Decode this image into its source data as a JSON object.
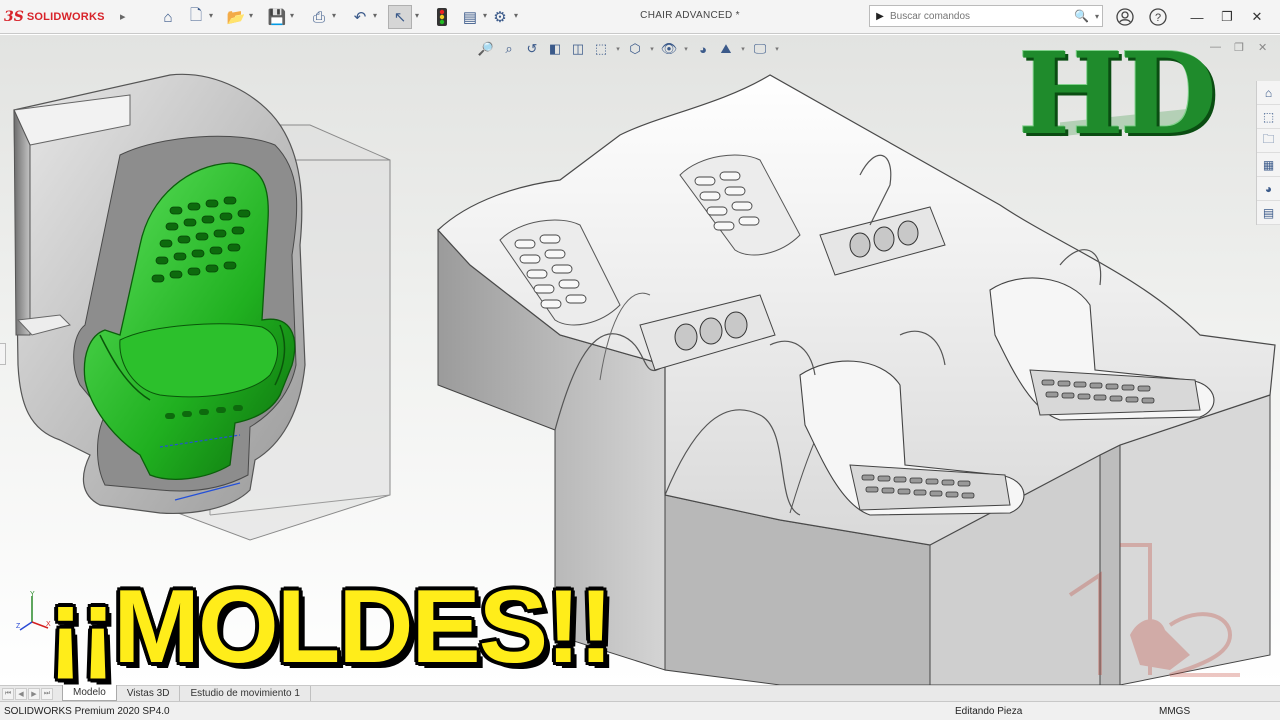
{
  "app": {
    "logo_prefix": "3S",
    "logo_name": "SOLIDWORKS"
  },
  "titlebar": {
    "document_title": "CHAIR ADVANCED *",
    "search_placeholder": "Buscar comandos"
  },
  "overlay": {
    "hd_label": "HD",
    "headline": "¡¡MOLDES!!"
  },
  "triad": {
    "x": "X",
    "y": "Y",
    "z": "Z"
  },
  "tabs": [
    {
      "label": "Modelo",
      "active": true
    },
    {
      "label": "Vistas 3D",
      "active": false
    },
    {
      "label": "Estudio de movimiento 1",
      "active": false
    }
  ],
  "status": {
    "product": "SOLIDWORKS Premium 2020 SP4.0",
    "mode": "Editando Pieza",
    "units": "MMGS"
  },
  "colors": {
    "accent": "#d8232a",
    "part_green": "#2fbf2f",
    "hd_green": "#1f8b2c",
    "headline_yellow": "#ffed1a"
  }
}
